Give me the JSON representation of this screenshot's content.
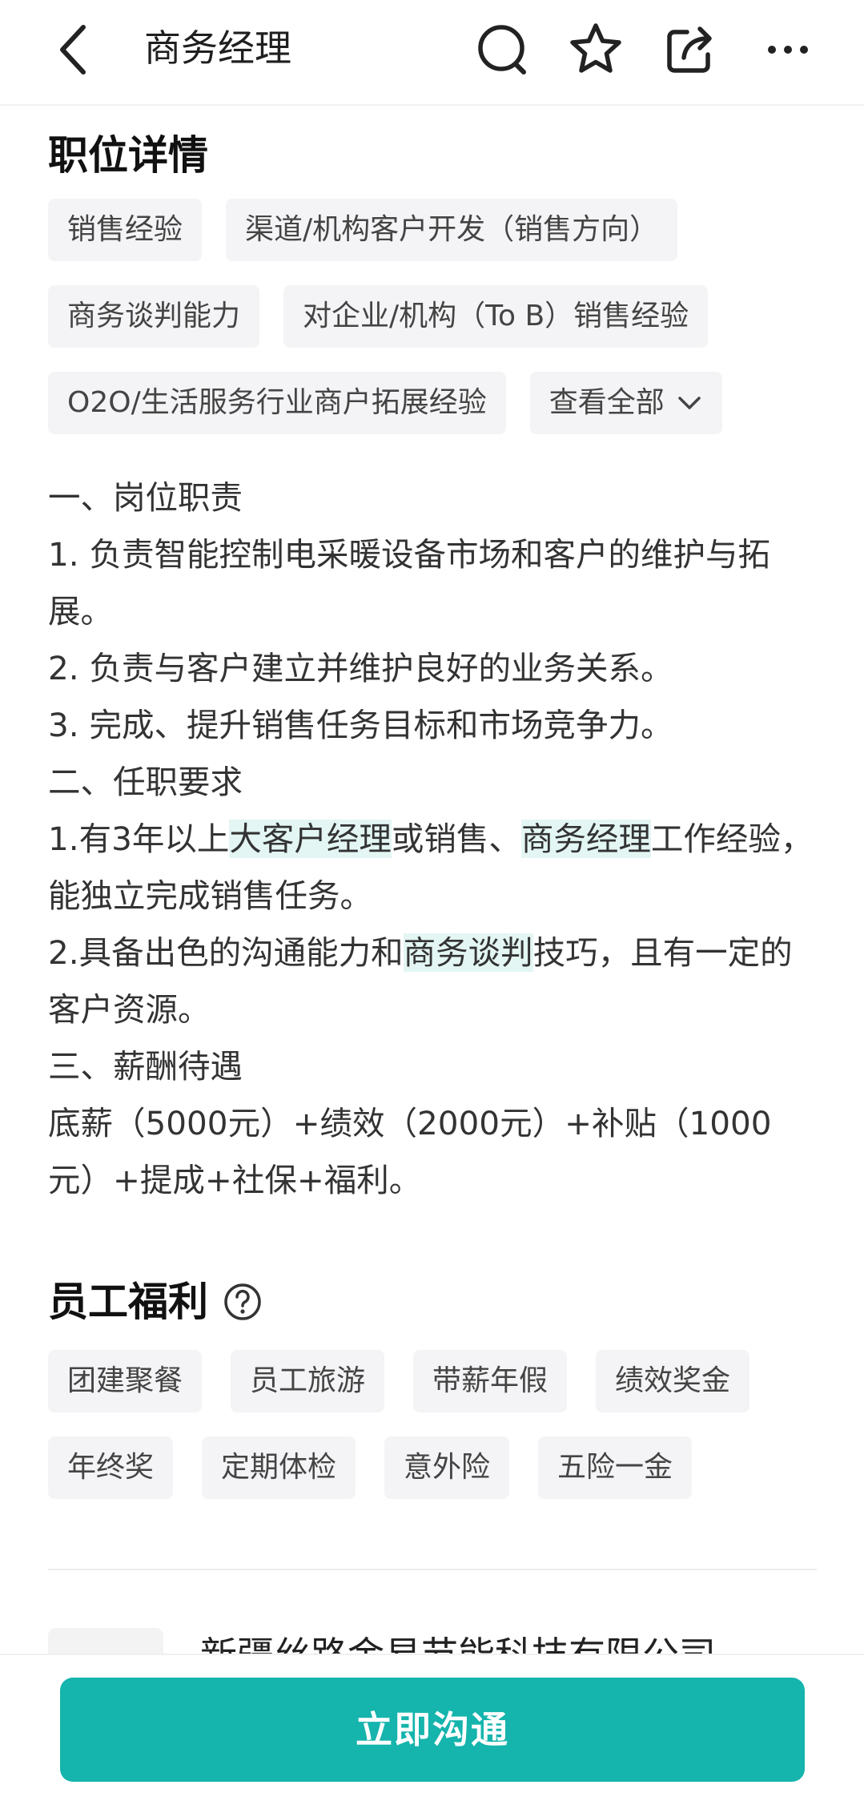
{
  "header": {
    "title": "商务经理",
    "icons": [
      "back-icon",
      "search-icon",
      "star-icon",
      "share-icon",
      "more-icon"
    ]
  },
  "job_details": {
    "title": "职位详情",
    "tags": [
      "销售经验",
      "渠道/机构客户开发（销售方向）",
      "商务谈判能力",
      "对企业/机构（To B）销售经验",
      "O2O/生活服务行业商户拓展经验"
    ],
    "view_all": "查看全部",
    "description": {
      "l1": "一、岗位职责",
      "l2": "1. 负责智能控制电采暖设备市场和客户的维护与拓展。",
      "l3": "2. 负责与客户建立并维护良好的业务关系。",
      "l4": "3. 完成、提升销售任务目标和市场竞争力。",
      "l5": "二、任职要求",
      "l6_a": "1.有3年以上",
      "l6_hl1": "大客户经理",
      "l6_b": "或销售、",
      "l6_hl2": "商务经理",
      "l6_c": "工作经验， 能独立完成销售任务。",
      "l7_a": "2.具备出色的沟通能力和",
      "l7_hl": "商务谈判",
      "l7_b": "技巧，且有一定的客户资源。",
      "l8": "三、薪酬待遇",
      "l9": "底薪（5000元）+绩效（2000元）+补贴（1000元）+提成+社保+福利。"
    }
  },
  "benefits": {
    "title": "员工福利",
    "items": [
      "团建聚餐",
      "员工旅游",
      "带薪年假",
      "绩效奖金",
      "年终奖",
      "定期体检",
      "意外险",
      "五险一金"
    ]
  },
  "company": {
    "name": "新疆丝路金易节能科技有限公司"
  },
  "action": {
    "chat_label": "立即沟通"
  },
  "colors": {
    "accent": "#15b4ad",
    "highlight": "#e3f6f3",
    "tag_bg": "#f4f4f6"
  }
}
